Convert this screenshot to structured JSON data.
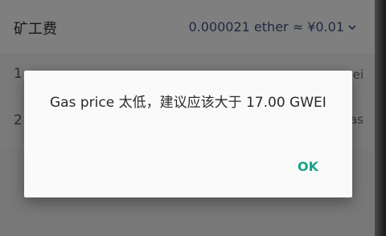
{
  "fee": {
    "label": "矿工费",
    "value": "0.000021 ether ≈ ¥0.01"
  },
  "background": {
    "row1_left": "1",
    "row1_right": "ei",
    "row2_left": "2",
    "row2_right": "as"
  },
  "dialog": {
    "message": "Gas price 太低，建议应该大于 17.00 GWEI",
    "ok_label": "OK"
  },
  "colors": {
    "accent": "#1aa28a",
    "fee_value": "#3a4f7a"
  }
}
